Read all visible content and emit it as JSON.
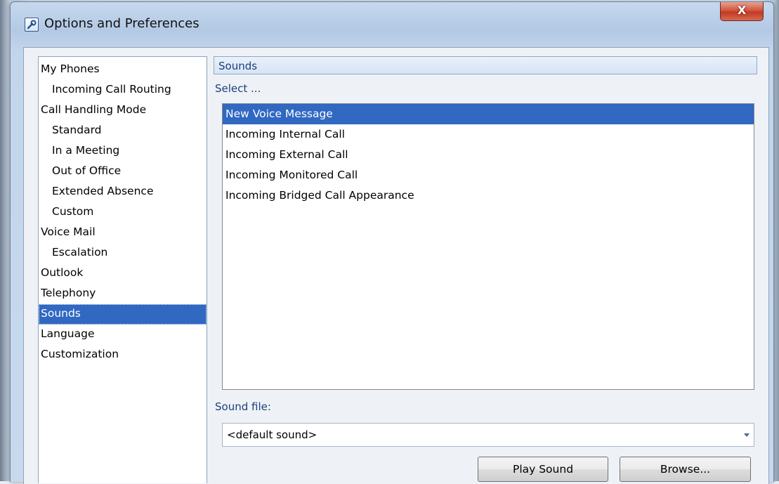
{
  "window": {
    "title": "Options and Preferences",
    "close_label": "X"
  },
  "nav": {
    "items": [
      {
        "label": "My Phones",
        "level": 0
      },
      {
        "label": "Incoming Call Routing",
        "level": 1
      },
      {
        "label": "Call Handling Mode",
        "level": 0
      },
      {
        "label": "Standard",
        "level": 1
      },
      {
        "label": "In a Meeting",
        "level": 1
      },
      {
        "label": "Out of Office",
        "level": 1
      },
      {
        "label": "Extended Absence",
        "level": 1
      },
      {
        "label": "Custom",
        "level": 1
      },
      {
        "label": "Voice Mail",
        "level": 0
      },
      {
        "label": "Escalation",
        "level": 1
      },
      {
        "label": "Outlook",
        "level": 0
      },
      {
        "label": "Telephony",
        "level": 0
      },
      {
        "label": "Sounds",
        "level": 0
      },
      {
        "label": "Language",
        "level": 0
      },
      {
        "label": "Customization",
        "level": 0
      }
    ],
    "selected": "Sounds"
  },
  "sounds": {
    "header": "Sounds",
    "select_label": "Select ...",
    "events": [
      "New Voice Message",
      "Incoming Internal Call",
      "Incoming External Call",
      "Incoming Monitored Call",
      "Incoming Bridged Call Appearance"
    ],
    "selected_event": "New Voice Message",
    "sound_file_label": "Sound file:",
    "sound_file_value": "<default sound>",
    "play_button": "Play Sound",
    "browse_button": "Browse..."
  },
  "colors": {
    "selection": "#3068c2",
    "header_text": "#1c3f7a",
    "close_button": "#c13a24"
  }
}
